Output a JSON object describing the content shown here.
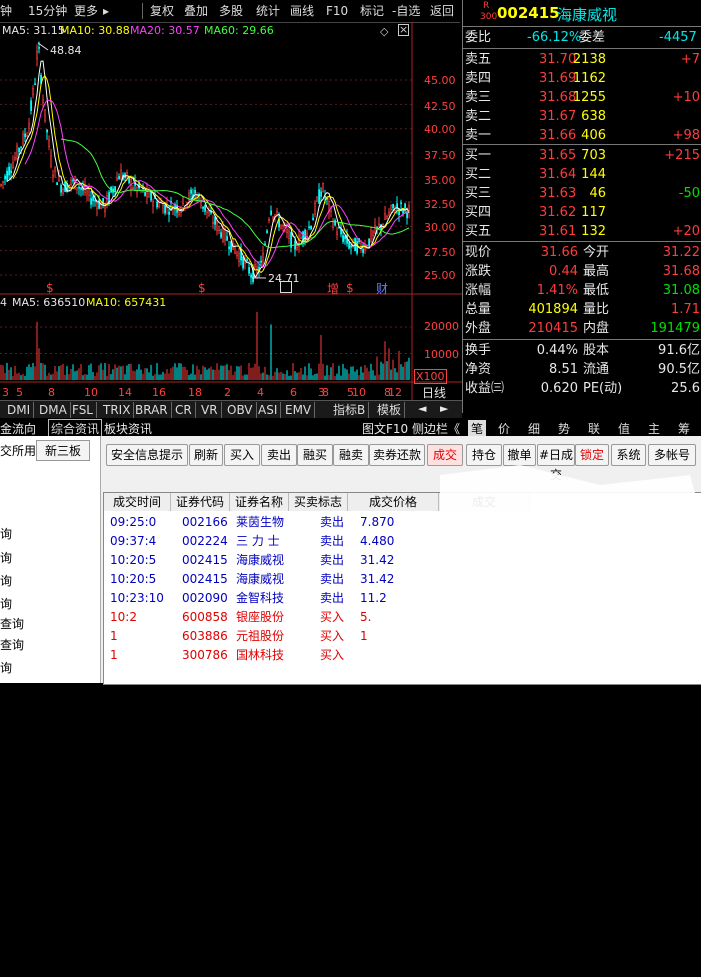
{
  "toolbar": {
    "items": [
      "钟",
      "15分钟",
      "更多",
      "复权",
      "叠加",
      "多股",
      "统计",
      "画线",
      "F10",
      "标记",
      "-自选",
      "返回"
    ]
  },
  "ma_legend": {
    "ma5": "MA5: 31.15",
    "ma10": "MA10: 30.88",
    "ma20": "MA20: 30.57",
    "ma60": "MA60: 29.66"
  },
  "price_axis": [
    "45.00",
    "42.50",
    "40.00",
    "37.50",
    "35.00",
    "32.50",
    "30.00",
    "27.50",
    "25.00"
  ],
  "high_label": "48.84",
  "low_label": "24.71",
  "markers": {
    "s": "$",
    "zeng": "增",
    "cai": "财"
  },
  "volume_legend": {
    "ma5": "MA5: 636510",
    "ma10": "MA10: 657431"
  },
  "volume_axis": [
    "20000",
    "10000",
    "X100"
  ],
  "x_ticks": [
    "3",
    "5",
    "8",
    "10",
    "14",
    "16",
    "18",
    "2",
    "4",
    "6",
    "8",
    "10",
    "12",
    "3",
    "5",
    "8"
  ],
  "daily": "日线",
  "indicator_tabs": [
    "DMI",
    "DMA",
    "FSL",
    "TRIX",
    "BRAR",
    "CR",
    "VR",
    "OBV",
    "ASI",
    "EMV",
    "指标B",
    "模板"
  ],
  "sub_tabs": [
    "金流向",
    "综合资讯",
    "板块资讯"
  ],
  "sub_right": [
    "图文F10",
    "侧边栏《"
  ],
  "right_tabs": [
    "笔",
    "价",
    "细",
    "势",
    "联",
    "值",
    "主",
    "筹"
  ],
  "quote": {
    "code_prefix": "R",
    "code_num": "300",
    "code": "002415",
    "name": "海康威视",
    "weibi_label": "委比",
    "weibi": "-66.12%",
    "weicha_label": "委差",
    "weicha": "-4457",
    "asks": [
      {
        "label": "卖五",
        "price": "31.70",
        "vol": "2138",
        "chg": "+7"
      },
      {
        "label": "卖四",
        "price": "31.69",
        "vol": "1162",
        "chg": ""
      },
      {
        "label": "卖三",
        "price": "31.68",
        "vol": "1255",
        "chg": "+10"
      },
      {
        "label": "卖二",
        "price": "31.67",
        "vol": "638",
        "chg": ""
      },
      {
        "label": "卖一",
        "price": "31.66",
        "vol": "406",
        "chg": "+98"
      }
    ],
    "bids": [
      {
        "label": "买一",
        "price": "31.65",
        "vol": "703",
        "chg": "+215"
      },
      {
        "label": "买二",
        "price": "31.64",
        "vol": "144",
        "chg": ""
      },
      {
        "label": "买三",
        "price": "31.63",
        "vol": "46",
        "chg": "-50"
      },
      {
        "label": "买四",
        "price": "31.62",
        "vol": "117",
        "chg": ""
      },
      {
        "label": "买五",
        "price": "31.61",
        "vol": "132",
        "chg": "+20"
      }
    ],
    "stats": [
      {
        "l1": "现价",
        "v1": "31.66",
        "l2": "今开",
        "v2": "31.22"
      },
      {
        "l1": "涨跌",
        "v1": "0.44",
        "l2": "最高",
        "v2": "31.68"
      },
      {
        "l1": "涨幅",
        "v1": "1.41%",
        "l2": "最低",
        "v2": "31.08"
      },
      {
        "l1": "总量",
        "v1": "401894",
        "l2": "量比",
        "v2": "1.71"
      },
      {
        "l1": "外盘",
        "v1": "210415",
        "l2": "内盘",
        "v2": "191479"
      }
    ],
    "stats2": [
      {
        "l1": "换手",
        "v1": "0.44%",
        "l2": "股本",
        "v2": "91.6亿"
      },
      {
        "l1": "净资",
        "v1": "8.51",
        "l2": "流通",
        "v2": "90.5亿"
      },
      {
        "l1": "收益㈢",
        "v1": "0.620",
        "l2": "PE(动)",
        "v2": "25.6"
      }
    ]
  },
  "nav": {
    "exchange_tab": "交所用",
    "third_board": "新三板",
    "items": [
      "询",
      "询",
      "询",
      "询",
      "查询",
      "查询",
      "询",
      "询"
    ]
  },
  "buttons": [
    "安全信息提示",
    "刷新",
    "买入",
    "卖出",
    "融买",
    "融卖",
    "卖券还款",
    "成交",
    "持仓",
    "撤单",
    "#日成交",
    "锁定",
    "系统",
    "多帐号"
  ],
  "grid": {
    "headers": [
      "成交时间",
      "证券代码",
      "证券名称",
      "买卖标志",
      "成交价格",
      "成交"
    ],
    "rows": [
      {
        "time": "09:25:0",
        "code": "002166",
        "name": "莱茵生物",
        "side": "卖出",
        "price": "7.870",
        "color": "blue"
      },
      {
        "time": "09:37:4",
        "code": "002224",
        "name": "三 力 士",
        "side": "卖出",
        "price": "4.480",
        "color": "blue"
      },
      {
        "time": "10:20:5",
        "code": "002415",
        "name": "海康威视",
        "side": "卖出",
        "price": "31.42",
        "color": "blue"
      },
      {
        "time": "10:20:5",
        "code": "002415",
        "name": "海康威视",
        "side": "卖出",
        "price": "31.42",
        "color": "blue"
      },
      {
        "time": "10:23:10",
        "code": "002090",
        "name": "金智科技",
        "side": "卖出",
        "price": "11.2",
        "color": "blue"
      },
      {
        "time": "10:2",
        "code": "600858",
        "name": "银座股份",
        "side": "买入",
        "price": "5.",
        "color": "red"
      },
      {
        "time": "1",
        "code": "603886",
        "name": "元祖股份",
        "side": "买入",
        "price": "1",
        "color": "red"
      },
      {
        "time": "1",
        "code": "300786",
        "name": "国林科技",
        "side": "买入",
        "price": "",
        "color": "red"
      }
    ]
  },
  "colors": {
    "up": "#ff3c3c",
    "down": "#00ffff",
    "ma5": "#ffffff",
    "ma10": "#ffff00",
    "ma20": "#ff00ff",
    "ma60": "#00ff00"
  }
}
